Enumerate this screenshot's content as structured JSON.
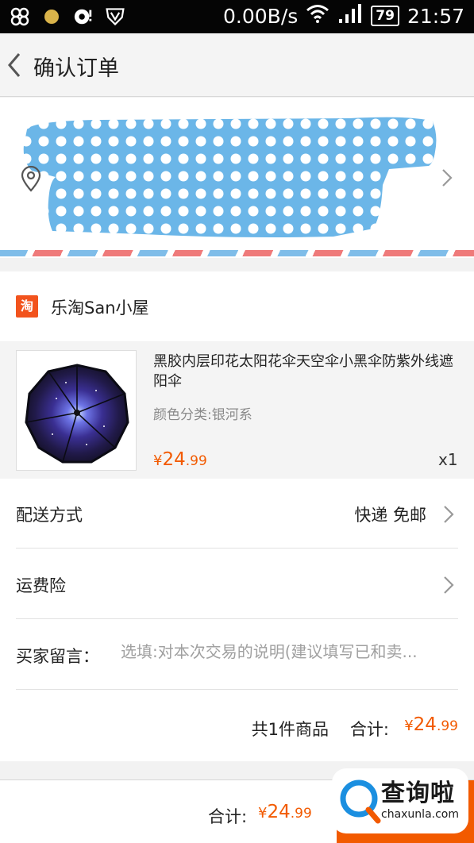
{
  "status_bar": {
    "speed": "0.00B/s",
    "battery": "79",
    "time": "21:57",
    "icons": [
      "app-icon",
      "circle-icon",
      "camera-icon",
      "shield-icon",
      "wifi-icon",
      "signal-icon"
    ]
  },
  "nav": {
    "back_icon": "chevron-left-icon",
    "title": "确认订单"
  },
  "address": {
    "location_icon": "location-pin-icon",
    "chevron_icon": "chevron-right-icon",
    "colors": {
      "redact_fill": "#6bb6e8",
      "airmail_blue": "#7fbde9",
      "airmail_red": "#ef7a7a"
    }
  },
  "shop": {
    "logo_text": "淘",
    "name": "乐淘San小屋"
  },
  "product": {
    "title": "黑胶内层印花太阳花伞天空伞小黑伞防紫外线遮阳伞",
    "variant": "颜色分类:银河系",
    "price": {
      "currency": "¥",
      "integer": "24",
      "decimal": ".99"
    },
    "quantity": "x1"
  },
  "delivery": {
    "label": "配送方式",
    "value": "快递 免邮"
  },
  "insurance": {
    "label": "运费险"
  },
  "message": {
    "label": "买家留言：",
    "placeholder": "选填:对本次交易的说明(建议填写已和卖..."
  },
  "summary": {
    "count": "共1件商品",
    "total_label": "合计:",
    "price": {
      "currency": "¥",
      "integer": "24",
      "decimal": ".99"
    }
  },
  "bottom_bar": {
    "total_label": "合计:",
    "price": {
      "currency": "¥",
      "integer": "24",
      "decimal": ".99"
    }
  },
  "watermark": {
    "text": "查询啦",
    "url": "chaxunla.com"
  },
  "colors": {
    "accent": "#f25a00",
    "shop_logo": "#f2531d"
  }
}
